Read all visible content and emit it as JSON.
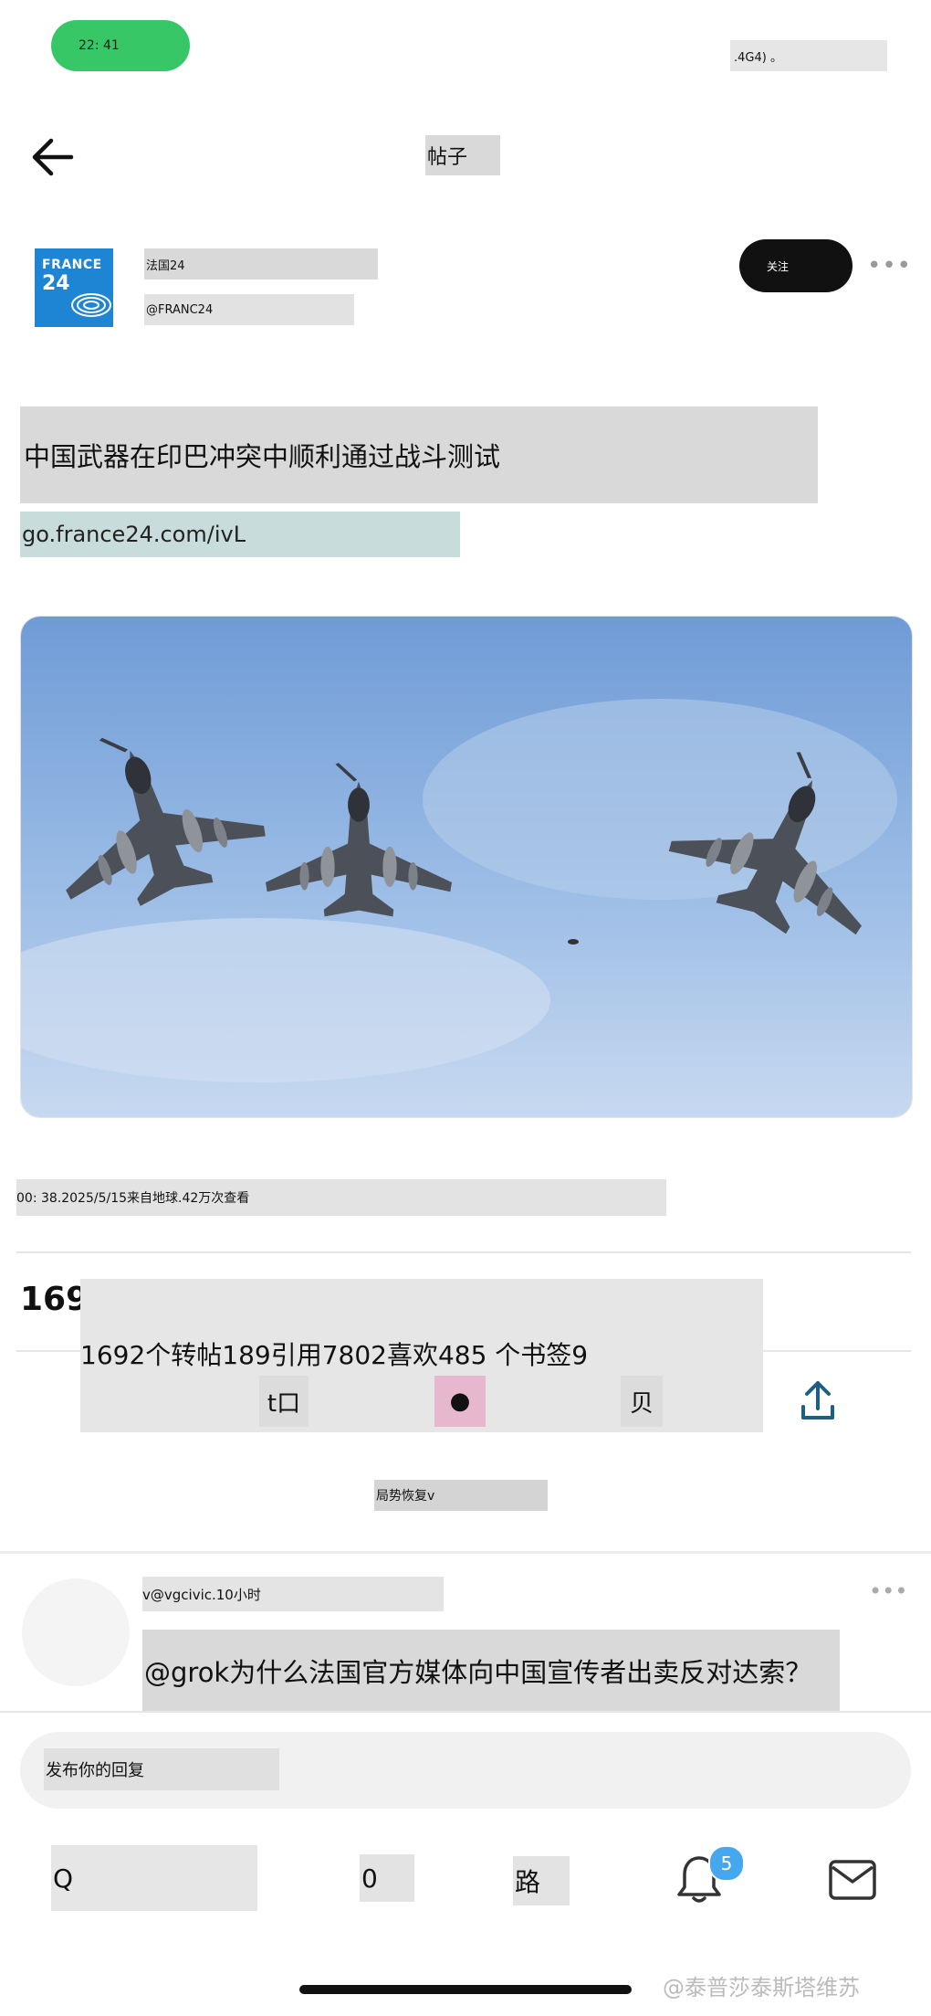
{
  "status_bar": {
    "time": "22: 41",
    "right": ".4G4) 。"
  },
  "header": {
    "title": "帖子"
  },
  "author": {
    "avatar_line1": "FRANCE",
    "avatar_line2": "24",
    "name": "法国24",
    "handle": "@FRANC24",
    "follow_label": "关注",
    "more": "•••"
  },
  "post": {
    "text": "中国武器在印巴冲突中顺利通过战斗测试",
    "link": "go.france24.com/ivL",
    "meta": "00: 38.2025/5/15来自地球.42万次查看"
  },
  "stats": {
    "partial": "169",
    "text": "1692个转帖189引用7802喜欢485 个书签9",
    "actions": [
      "t口",
      "●",
      "贝"
    ]
  },
  "replies_label": "局势恢复v",
  "comment": {
    "meta": "v@vgcivic.10小时",
    "more": "•••",
    "text": "@grok为什么法国官方媒体向中国宣传者出卖反对达索？"
  },
  "reply_input": {
    "placeholder": "发布你的回复"
  },
  "bottom_nav": {
    "items": [
      "Q",
      "0",
      "路"
    ],
    "badge": "5"
  },
  "watermark": "@泰普莎泰斯塔维苏",
  "colors": {
    "status_pill": "#38c766",
    "follow_bg": "#111111",
    "badge": "#45a8ee",
    "avatar_bg": "#1e84d4"
  }
}
